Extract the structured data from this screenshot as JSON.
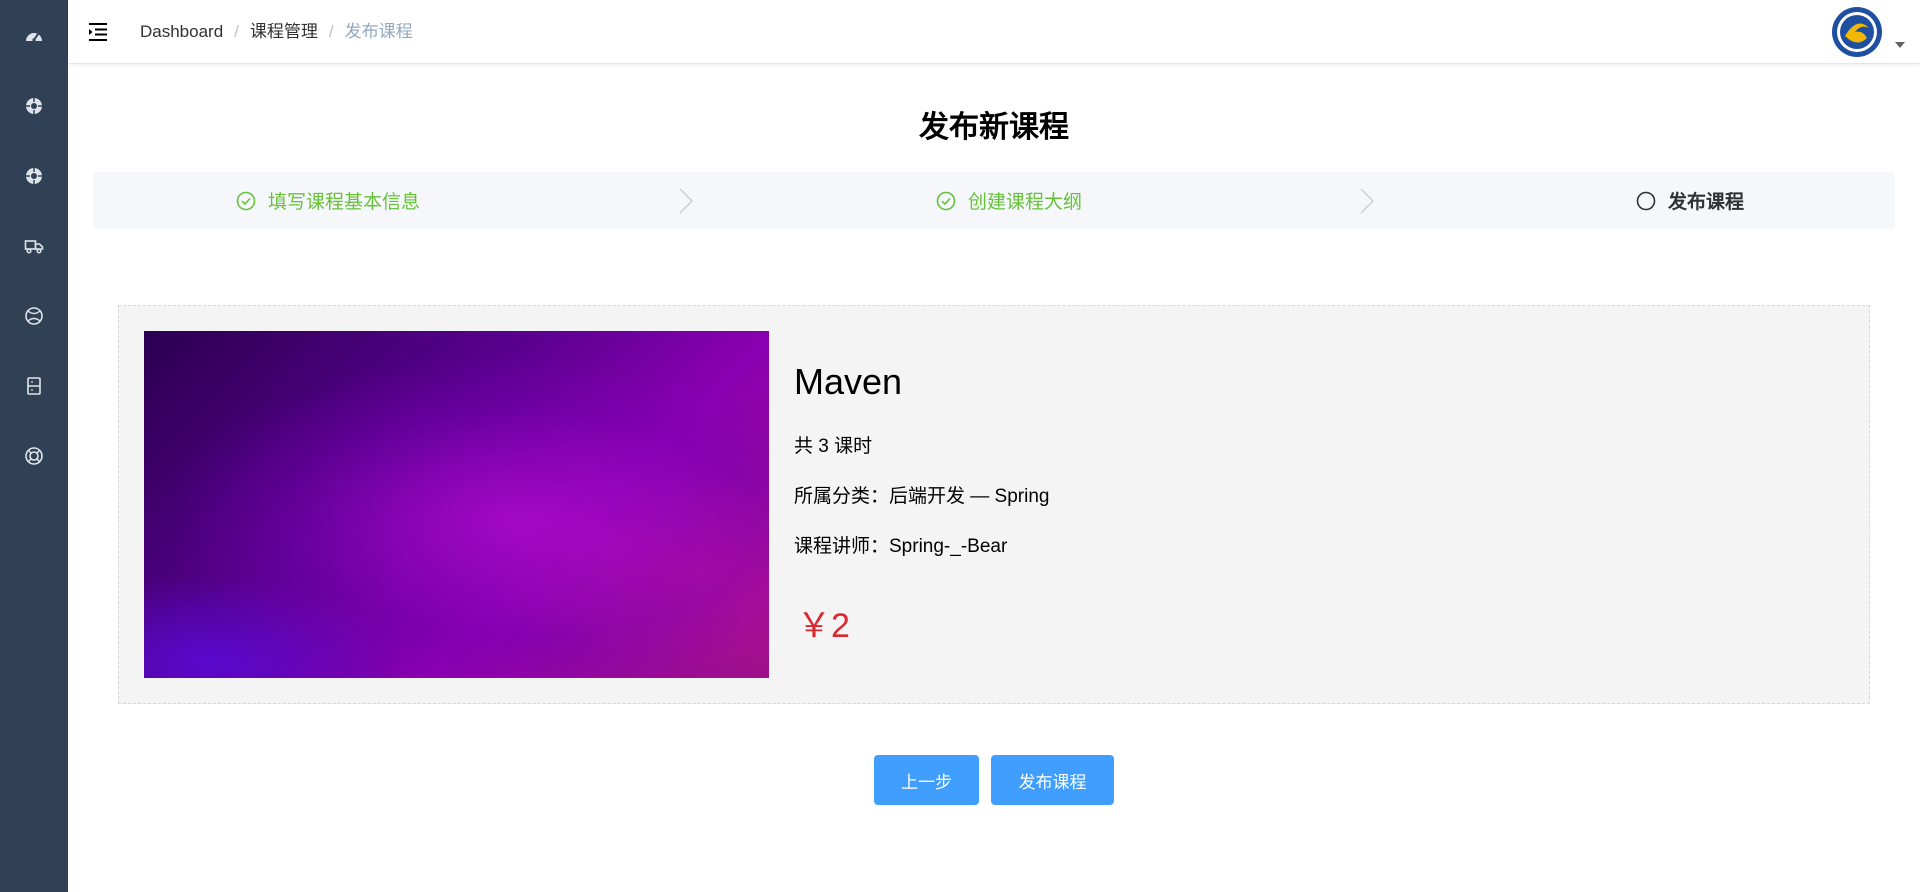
{
  "sidebar": {
    "items": [
      {
        "icon": "dashboard-icon"
      },
      {
        "icon": "course-icon"
      },
      {
        "icon": "course-manage-icon"
      },
      {
        "icon": "truck-icon"
      },
      {
        "icon": "basketball-icon"
      },
      {
        "icon": "document-icon"
      },
      {
        "icon": "lifebuoy-icon"
      }
    ],
    "background": "#304156"
  },
  "navbar": {
    "breadcrumb": [
      "Dashboard",
      "课程管理",
      "发布课程"
    ],
    "separator": "/"
  },
  "page": {
    "title": "发布新课程"
  },
  "steps": [
    {
      "label": "填写课程基本信息",
      "status": "done"
    },
    {
      "label": "创建课程大纲",
      "status": "done"
    },
    {
      "label": "发布课程",
      "status": "active"
    }
  ],
  "course": {
    "title": "Maven",
    "lessons": "共 3 课时",
    "category": "所属分类：后端开发 — Spring",
    "teacher": "课程讲师：Spring-_-Bear",
    "price": "￥2"
  },
  "actions": {
    "prev_label": "上一步",
    "publish_label": "发布课程"
  },
  "colors": {
    "primary": "#409eff",
    "success": "#67c23a",
    "price": "#d8292f"
  }
}
